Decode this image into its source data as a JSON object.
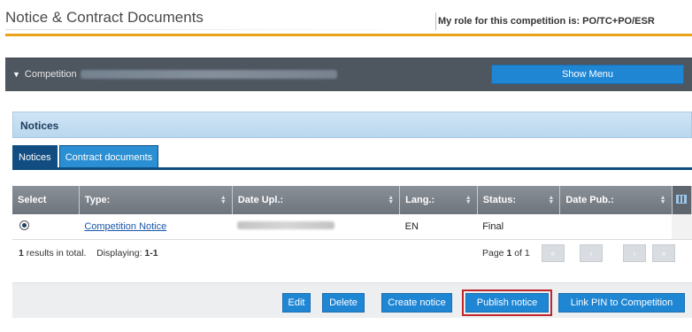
{
  "header": {
    "title": "Notice & Contract Documents",
    "role_text": "My role for this competition is: PO/TC+PO/ESR"
  },
  "competition_bar": {
    "label": "Competition",
    "chevron_icon": "chevron-down-icon",
    "show_menu_label": "Show Menu"
  },
  "panel": {
    "title": "Notices",
    "tabs": [
      {
        "label": "Notices",
        "active": true
      },
      {
        "label": "Contract documents",
        "active": false
      }
    ]
  },
  "table": {
    "columns": [
      "Select",
      "Type:",
      "Date Upl.:",
      "Lang.:",
      "Status:",
      "Date Pub.:"
    ],
    "rows": [
      {
        "type": "Competition Notice",
        "lang": "EN",
        "status": "Final",
        "date_pub": ""
      }
    ]
  },
  "footer": {
    "results_count": "1",
    "results_suffix": "results in total.",
    "displaying_label": "Displaying:",
    "displaying_range": "1-1",
    "page_prefix": "Page",
    "page_current": "1",
    "page_of": "of 1"
  },
  "actions": {
    "edit": "Edit",
    "delete": "Delete",
    "create": "Create notice",
    "publish": "Publish notice",
    "link_pin": "Link PIN to Competition"
  },
  "colors": {
    "accent": "#1f86d4",
    "gold_rule": "#e9a21a",
    "highlight_border": "#c0272d"
  }
}
